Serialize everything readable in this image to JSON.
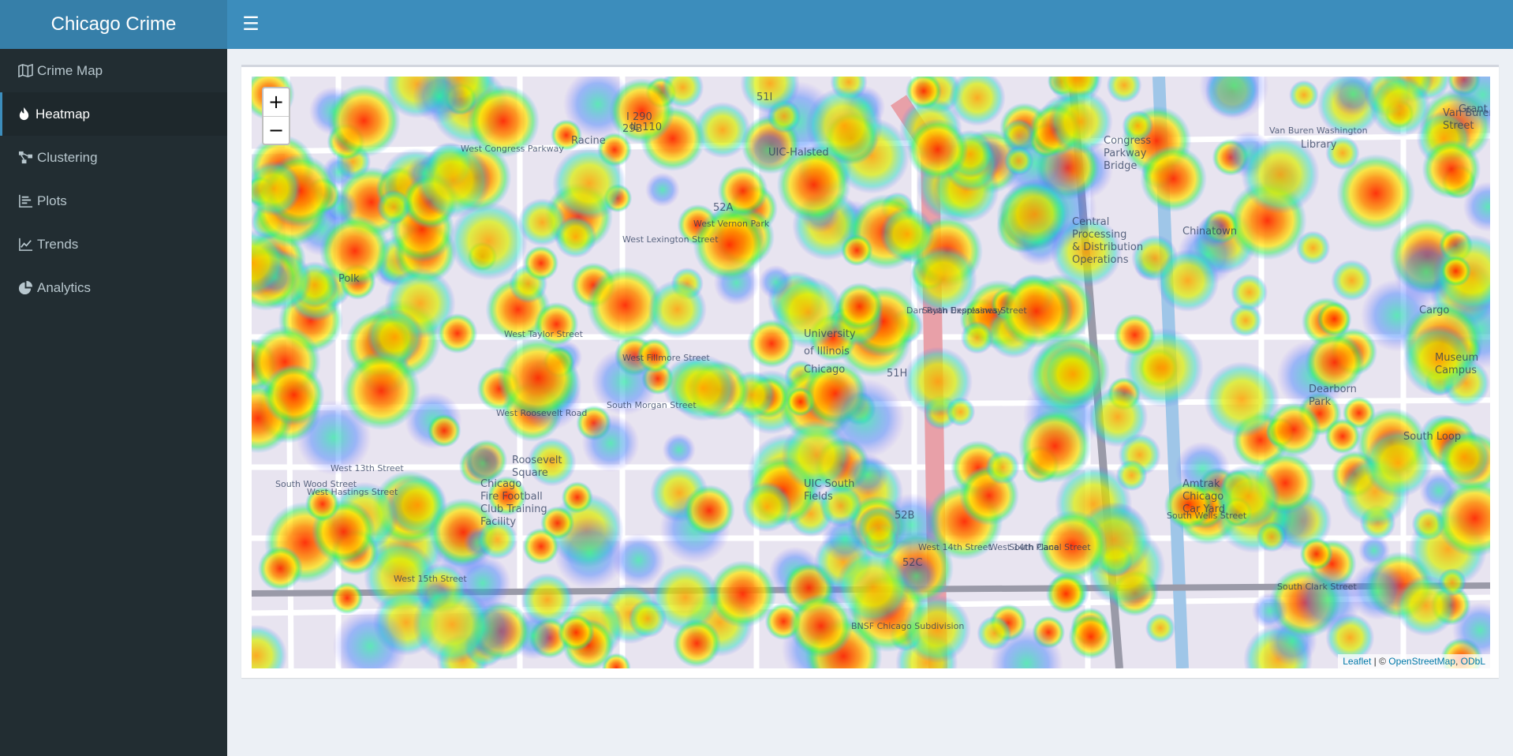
{
  "header": {
    "brand": "Chicago Crime",
    "toggle_icon": "☰"
  },
  "sidebar": {
    "items": [
      {
        "label": "Crime Map",
        "icon": "map-icon",
        "active": false
      },
      {
        "label": "Heatmap",
        "icon": "fire-icon",
        "active": true
      },
      {
        "label": "Clustering",
        "icon": "clustering-icon",
        "active": false
      },
      {
        "label": "Plots",
        "icon": "bar-list-icon",
        "active": false
      },
      {
        "label": "Trends",
        "icon": "line-chart-icon",
        "active": false
      },
      {
        "label": "Analytics",
        "icon": "pie-chart-icon",
        "active": false
      }
    ]
  },
  "map": {
    "zoom_in": "+",
    "zoom_out": "−",
    "attribution": {
      "leaflet": "Leaflet",
      "separator": " | © ",
      "osm": "OpenStreetMap",
      "comma": ", ",
      "odbl": "ODbL"
    },
    "labels": [
      "West Congress Parkway",
      "Racine",
      "UIC-Halsted",
      "Dan Ryan Expressway",
      "University",
      "of Illinois",
      "Chicago",
      "West Taylor Street",
      "West Roosevelt Road",
      "West 13th Street",
      "West Hastings Street",
      "West 15th Street",
      "West 14th Place",
      "Central",
      "Processing",
      "& Distribution",
      "Operations",
      "Congress",
      "Parkway",
      "Bridge",
      "Amtrak",
      "Chicago",
      "Car Yard",
      "South Wells Street",
      "South Clark Street",
      "UIC South",
      "Fields",
      "Chicago",
      "Fire Football",
      "Club Training",
      "Facility",
      "Roosevelt",
      "Square",
      "BNSF Chicago Subdivision",
      "Dearborn",
      "Park",
      "Museum",
      "Campus",
      "South Loop",
      "Van Buren Washington",
      "Library",
      "Grant",
      "Polk",
      "Van Buren",
      "Street",
      "South Canal Street",
      "South Desplaines Street",
      "West Vernon Park",
      "West Lexington Street",
      "West Fillmore Street",
      "IL 110",
      "I 290",
      "29B",
      "51I",
      "52A",
      "51H",
      "52B",
      "52C",
      "West 14th Street",
      "South Wood Street",
      "South Morgan Street",
      "Chinatown",
      "Cargo"
    ]
  }
}
